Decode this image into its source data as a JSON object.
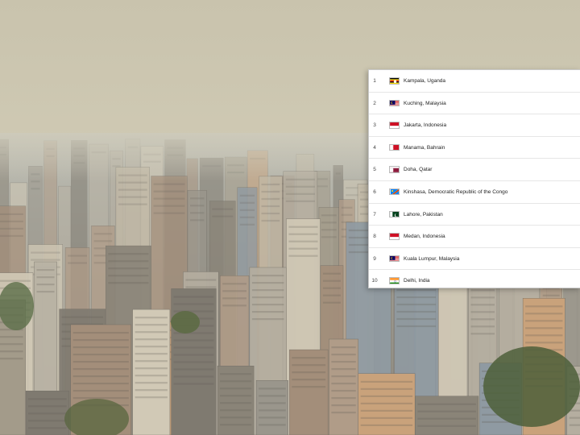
{
  "ranking": {
    "items": [
      {
        "rank": "1",
        "city": "Kampala, Uganda",
        "flag": "uganda-flag-icon"
      },
      {
        "rank": "2",
        "city": "Kuching, Malaysia",
        "flag": "malaysia-flag-icon"
      },
      {
        "rank": "3",
        "city": "Jakarta, Indonesia",
        "flag": "indonesia-flag-icon"
      },
      {
        "rank": "4",
        "city": "Manama, Bahrain",
        "flag": "bahrain-flag-icon"
      },
      {
        "rank": "5",
        "city": "Doha, Qatar",
        "flag": "qatar-flag-icon"
      },
      {
        "rank": "6",
        "city": "Kinshasa, Democratic Republic of the Congo",
        "flag": "drc-flag-icon"
      },
      {
        "rank": "7",
        "city": "Lahore, Pakistan",
        "flag": "pakistan-flag-icon"
      },
      {
        "rank": "8",
        "city": "Medan, Indonesia",
        "flag": "indonesia-flag-icon"
      },
      {
        "rank": "9",
        "city": "Kuala Lumpur, Malaysia",
        "flag": "malaysia-flag-icon"
      },
      {
        "rank": "10",
        "city": "Delhi, India",
        "flag": "india-flag-icon"
      }
    ]
  }
}
